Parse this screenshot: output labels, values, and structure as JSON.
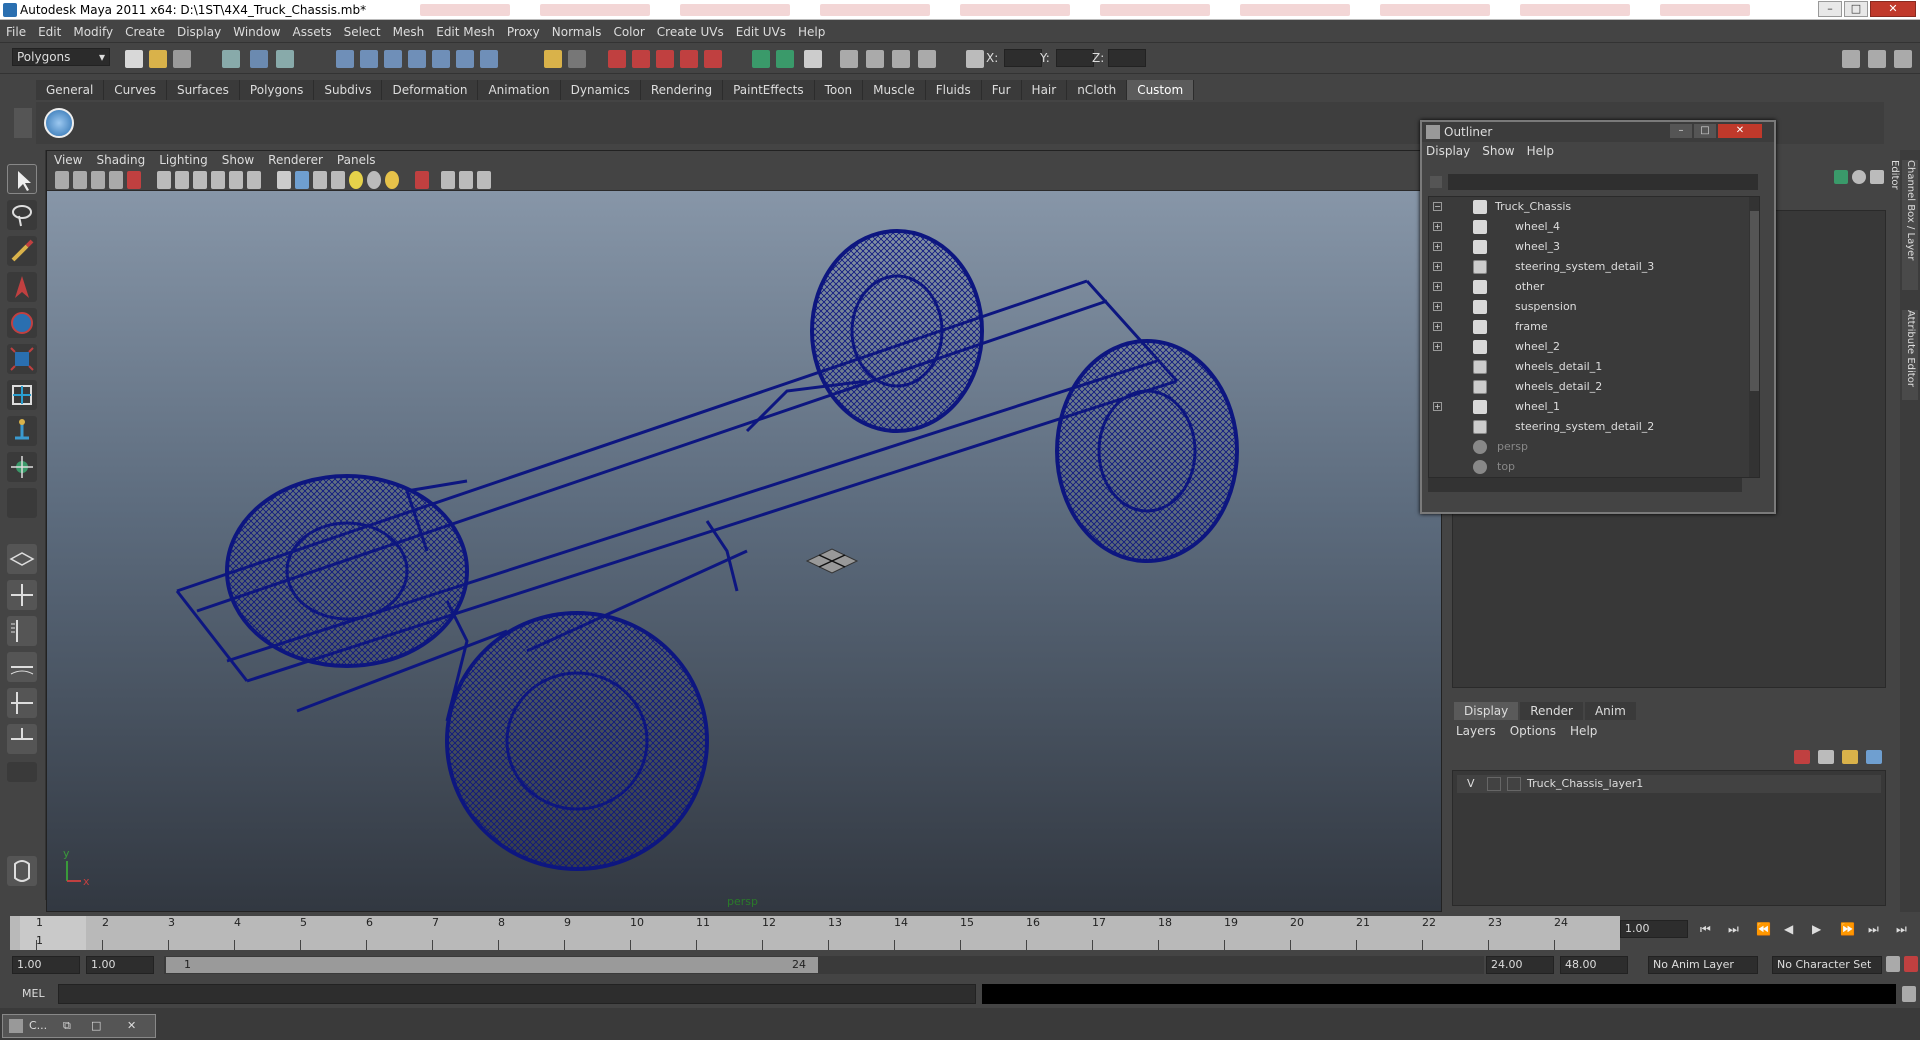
{
  "window": {
    "title": "Autodesk Maya 2011 x64: D:\\1ST\\4X4_Truck_Chassis.mb*"
  },
  "menubar": [
    "File",
    "Edit",
    "Modify",
    "Create",
    "Display",
    "Window",
    "Assets",
    "Select",
    "Mesh",
    "Edit Mesh",
    "Proxy",
    "Normals",
    "Color",
    "Create UVs",
    "Edit UVs",
    "Help"
  ],
  "status": {
    "mode": "Polygons",
    "x_label": "X:",
    "y_label": "Y:",
    "z_label": "Z:"
  },
  "shelf": {
    "tabs": [
      "General",
      "Curves",
      "Surfaces",
      "Polygons",
      "Subdivs",
      "Deformation",
      "Animation",
      "Dynamics",
      "Rendering",
      "PaintEffects",
      "Toon",
      "Muscle",
      "Fluids",
      "Fur",
      "Hair",
      "nCloth",
      "Custom"
    ],
    "active": "Custom"
  },
  "viewport": {
    "menu": [
      "View",
      "Shading",
      "Lighting",
      "Show",
      "Renderer",
      "Panels"
    ],
    "camera": "persp",
    "axis_y": "y",
    "axis_x": "x"
  },
  "outliner": {
    "title": "Outliner",
    "menu": [
      "Display",
      "Show",
      "Help"
    ],
    "items": [
      {
        "label": "Truck_Chassis",
        "expand": "−"
      },
      {
        "label": "wheel_4",
        "expand": "+"
      },
      {
        "label": "wheel_3",
        "expand": "+"
      },
      {
        "label": "steering_system_detail_3",
        "expand": "+"
      },
      {
        "label": "other",
        "expand": "+"
      },
      {
        "label": "suspension",
        "expand": "+"
      },
      {
        "label": "frame",
        "expand": "+"
      },
      {
        "label": "wheel_2",
        "expand": "+"
      },
      {
        "label": "wheels_detail_1",
        "expand": ""
      },
      {
        "label": "wheels_detail_2",
        "expand": ""
      },
      {
        "label": "wheel_1",
        "expand": "+"
      },
      {
        "label": "steering_system_detail_2",
        "expand": ""
      },
      {
        "label": "persp",
        "expand": ""
      },
      {
        "label": "top",
        "expand": ""
      }
    ]
  },
  "layers": {
    "tabs": [
      "Display",
      "Render",
      "Anim"
    ],
    "menu": [
      "Layers",
      "Options",
      "Help"
    ],
    "row": {
      "visible": "V",
      "name": "Truck_Chassis_layer1"
    }
  },
  "side_tabs": [
    "Channel Box / Layer Editor",
    "Attribute Editor"
  ],
  "timeline": {
    "ticks": [
      "1",
      "2",
      "3",
      "4",
      "5",
      "6",
      "7",
      "8",
      "9",
      "10",
      "11",
      "12",
      "13",
      "14",
      "15",
      "16",
      "17",
      "18",
      "19",
      "20",
      "21",
      "22",
      "23",
      "24"
    ],
    "current_frame": "1.00"
  },
  "range": {
    "start": "1.00",
    "start2": "1.00",
    "slider_start": "1",
    "slider_end": "24",
    "end": "24.00",
    "end2": "48.00",
    "anim_layer": "No Anim Layer",
    "char_set": "No Character Set"
  },
  "cmd": {
    "label": "MEL"
  },
  "taskbar": {
    "label": "C..."
  },
  "colors": {
    "wire": "#0d1680",
    "bg_top": "#8796a8",
    "bg_bottom": "#323841"
  }
}
